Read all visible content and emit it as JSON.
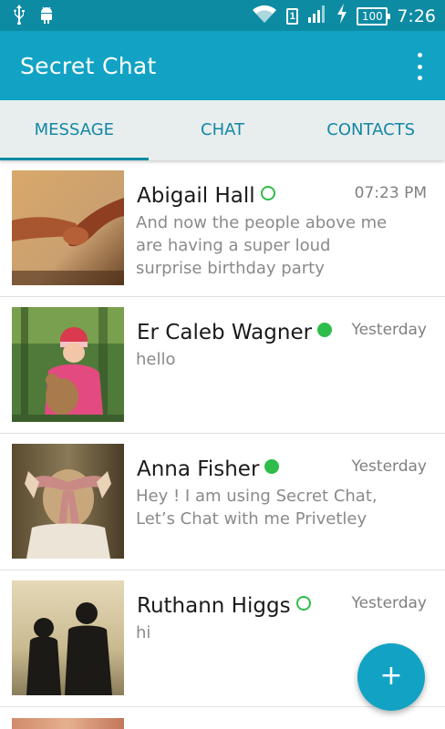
{
  "status_bar": {
    "time": "7:26",
    "battery": "100",
    "sim": "1",
    "icons": [
      "usb-icon",
      "android-icon",
      "wifi-icon",
      "sim-icon",
      "signal-icon",
      "charging-icon",
      "battery-icon"
    ]
  },
  "app_bar": {
    "title": "Secret Chat",
    "menu_icon": "more-vert-icon"
  },
  "tabs": [
    {
      "label": "MESSAGE",
      "active": true
    },
    {
      "label": "CHAT",
      "active": false
    },
    {
      "label": "CONTACTS",
      "active": false
    }
  ],
  "conversations": [
    {
      "name": "Abigail Hall",
      "status": "offline",
      "time": "07:23 PM",
      "message": "And now the people above me are having a super  loud surprise birthday party",
      "avatar": "holding-hands-photo"
    },
    {
      "name": "Er Caleb Wagner",
      "status": "online",
      "time": "Yesterday",
      "message": "hello",
      "avatar": "child-with-teddy-photo"
    },
    {
      "name": "Anna Fisher",
      "status": "online",
      "time": "Yesterday",
      "message": "Hey !  I am using Secret Chat, Let’s Chat with me Privetley",
      "avatar": "blindfold-girl-photo"
    },
    {
      "name": "Ruthann Higgs",
      "status": "offline",
      "time": "Yesterday",
      "message": "hi",
      "avatar": "couple-silhouette-photo"
    }
  ],
  "fab": {
    "label": "+",
    "icon": "add-icon"
  },
  "colors": {
    "status_bar": "#0d8ba3",
    "app_bar": "#12a3c4",
    "tab_text": "#1487a4",
    "tab_bg": "#e8eeee",
    "online": "#2ebd4a",
    "fab": "#12a3c4"
  }
}
